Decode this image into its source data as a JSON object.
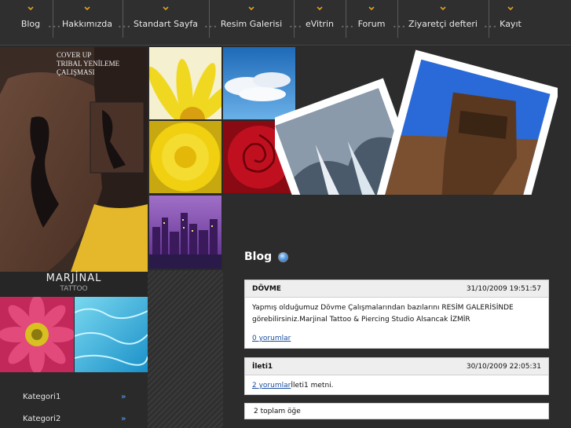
{
  "nav": {
    "items": [
      {
        "label": "Blog"
      },
      {
        "label": "Hakkımızda"
      },
      {
        "label": "Standart Sayfa"
      },
      {
        "label": "Resim Galerisi"
      },
      {
        "label": "eVitrin"
      },
      {
        "label": "Forum"
      },
      {
        "label": "Ziyaretçi defteri"
      },
      {
        "label": "Kayıt"
      }
    ]
  },
  "hero": {
    "caption_line1": "COVER UP",
    "caption_line2": "TRIBAL YENİLEME",
    "caption_line3": "ÇALIŞMASI"
  },
  "brand": {
    "name": "MARJİNAL",
    "subtitle": "TATTOO"
  },
  "sidebar": {
    "categories": [
      {
        "label": "Kategori1",
        "arrow": "»"
      },
      {
        "label": "Kategori2",
        "arrow": "»"
      }
    ]
  },
  "blog": {
    "title": "Blog",
    "posts": [
      {
        "title": "DÖVME",
        "date": "31/10/2009 19:51:57",
        "body": "Yapmış olduğumuz Dövme Çalışmalarından bazılarını  RESİM GALERİSİNDE görebilirsiniz.Marjinal Tattoo & Piercing Studio Alsancak İZMİR",
        "comments": "0 yorumlar"
      },
      {
        "title": "İleti1",
        "date": "30/10/2009 22:05:31",
        "comments": "2 yorumlar",
        "body": "İleti1 metni."
      }
    ],
    "total": "2 toplam öğe"
  },
  "colors": {
    "accent": "#4a90d9",
    "chevron": "#e0a020",
    "link": "#1a4fa0"
  }
}
